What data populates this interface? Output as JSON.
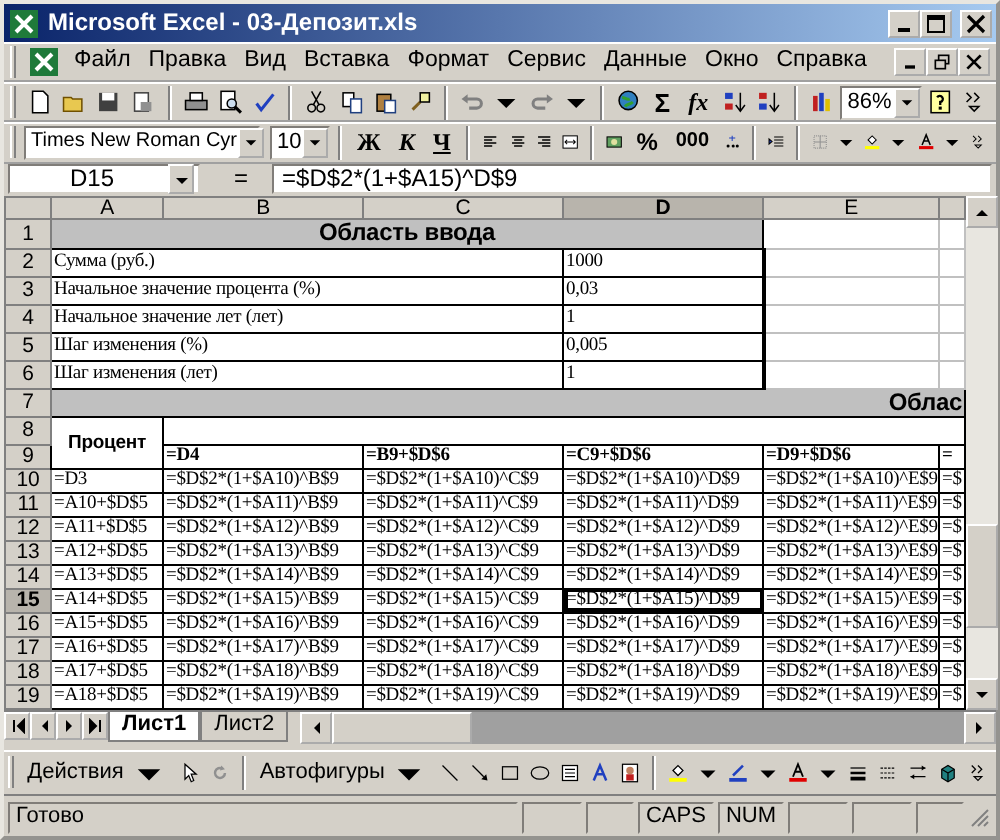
{
  "window": {
    "title": "Microsoft Excel - 03-Депозит.xls"
  },
  "menu": [
    "Файл",
    "Правка",
    "Вид",
    "Вставка",
    "Формат",
    "Сервис",
    "Данные",
    "Окно",
    "Справка"
  ],
  "standard_toolbar": {
    "autosum": "Σ",
    "function": "fx",
    "zoom": "86%"
  },
  "formatting_toolbar": {
    "font": "Times New Roman Cyr",
    "size": "10",
    "styles": [
      "Ж",
      "К",
      "Ч"
    ],
    "percent": "%",
    "thousands": "000"
  },
  "formula_bar": {
    "name_box": "D15",
    "equals": "=",
    "formula": "=$D$2*(1+$A15)^D$9"
  },
  "columns": [
    {
      "label": "A",
      "selected": false
    },
    {
      "label": "B",
      "selected": false
    },
    {
      "label": "C",
      "selected": false
    },
    {
      "label": "D",
      "selected": true
    },
    {
      "label": "E",
      "selected": false
    }
  ],
  "sheet": {
    "title_row": {
      "number": "1",
      "text": "Область ввода"
    },
    "inputs": [
      {
        "number": "2",
        "label": "Сумма (руб.)",
        "value": "1000"
      },
      {
        "number": "3",
        "label": "Начальное значение процента (%)",
        "value": "0,03"
      },
      {
        "number": "4",
        "label": "Начальное значение лет (лет)",
        "value": "1"
      },
      {
        "number": "5",
        "label": "Шаг изменения (%)",
        "value": "0,005"
      },
      {
        "number": "6",
        "label": "Шаг изменения (лет)",
        "value": "1"
      }
    ],
    "section_row": {
      "number": "7",
      "text": "Облас"
    },
    "header_rows": {
      "numbers": [
        "8",
        "9"
      ],
      "label": "Процент",
      "row_9": [
        "=D4",
        "=B9+$D$6",
        "=C9+$D$6",
        "=D9+$D$6",
        "="
      ]
    },
    "rows": [
      {
        "number": "10",
        "selected": false,
        "cells": [
          "=D3",
          "=$D$2*(1+$A10)^B$9",
          "=$D$2*(1+$A10)^C$9",
          "=$D$2*(1+$A10)^D$9",
          "=$D$2*(1+$A10)^E$9",
          "=$"
        ]
      },
      {
        "number": "11",
        "selected": false,
        "cells": [
          "=A10+$D$5",
          "=$D$2*(1+$A11)^B$9",
          "=$D$2*(1+$A11)^C$9",
          "=$D$2*(1+$A11)^D$9",
          "=$D$2*(1+$A11)^E$9",
          "=$"
        ]
      },
      {
        "number": "12",
        "selected": false,
        "cells": [
          "=A11+$D$5",
          "=$D$2*(1+$A12)^B$9",
          "=$D$2*(1+$A12)^C$9",
          "=$D$2*(1+$A12)^D$9",
          "=$D$2*(1+$A12)^E$9",
          "=$"
        ]
      },
      {
        "number": "13",
        "selected": false,
        "cells": [
          "=A12+$D$5",
          "=$D$2*(1+$A13)^B$9",
          "=$D$2*(1+$A13)^C$9",
          "=$D$2*(1+$A13)^D$9",
          "=$D$2*(1+$A13)^E$9",
          "=$"
        ]
      },
      {
        "number": "14",
        "selected": false,
        "cells": [
          "=A13+$D$5",
          "=$D$2*(1+$A14)^B$9",
          "=$D$2*(1+$A14)^C$9",
          "=$D$2*(1+$A14)^D$9",
          "=$D$2*(1+$A14)^E$9",
          "=$"
        ]
      },
      {
        "number": "15",
        "selected": true,
        "cells": [
          "=A14+$D$5",
          "=$D$2*(1+$A15)^B$9",
          "=$D$2*(1+$A15)^C$9",
          "=$D$2*(1+$A15)^D$9",
          "=$D$2*(1+$A15)^E$9",
          "=$"
        ]
      },
      {
        "number": "16",
        "selected": false,
        "cells": [
          "=A15+$D$5",
          "=$D$2*(1+$A16)^B$9",
          "=$D$2*(1+$A16)^C$9",
          "=$D$2*(1+$A16)^D$9",
          "=$D$2*(1+$A16)^E$9",
          "=$"
        ]
      },
      {
        "number": "17",
        "selected": false,
        "cells": [
          "=A16+$D$5",
          "=$D$2*(1+$A17)^B$9",
          "=$D$2*(1+$A17)^C$9",
          "=$D$2*(1+$A17)^D$9",
          "=$D$2*(1+$A17)^E$9",
          "=$"
        ]
      },
      {
        "number": "18",
        "selected": false,
        "cells": [
          "=A17+$D$5",
          "=$D$2*(1+$A18)^B$9",
          "=$D$2*(1+$A18)^C$9",
          "=$D$2*(1+$A18)^D$9",
          "=$D$2*(1+$A18)^E$9",
          "=$"
        ]
      },
      {
        "number": "19",
        "selected": false,
        "cells": [
          "=A18+$D$5",
          "=$D$2*(1+$A19)^B$9",
          "=$D$2*(1+$A19)^C$9",
          "=$D$2*(1+$A19)^D$9",
          "=$D$2*(1+$A19)^E$9",
          "=$"
        ]
      }
    ]
  },
  "sheet_tabs": [
    {
      "label": "Лист1",
      "selected": true
    },
    {
      "label": "Лист2",
      "selected": false
    }
  ],
  "drawing_toolbar": {
    "actions": "Действия",
    "autoshapes": "Автофигуры"
  },
  "status_bar": {
    "text": "Готово",
    "indicators": [
      "CAPS",
      "NUM"
    ]
  }
}
